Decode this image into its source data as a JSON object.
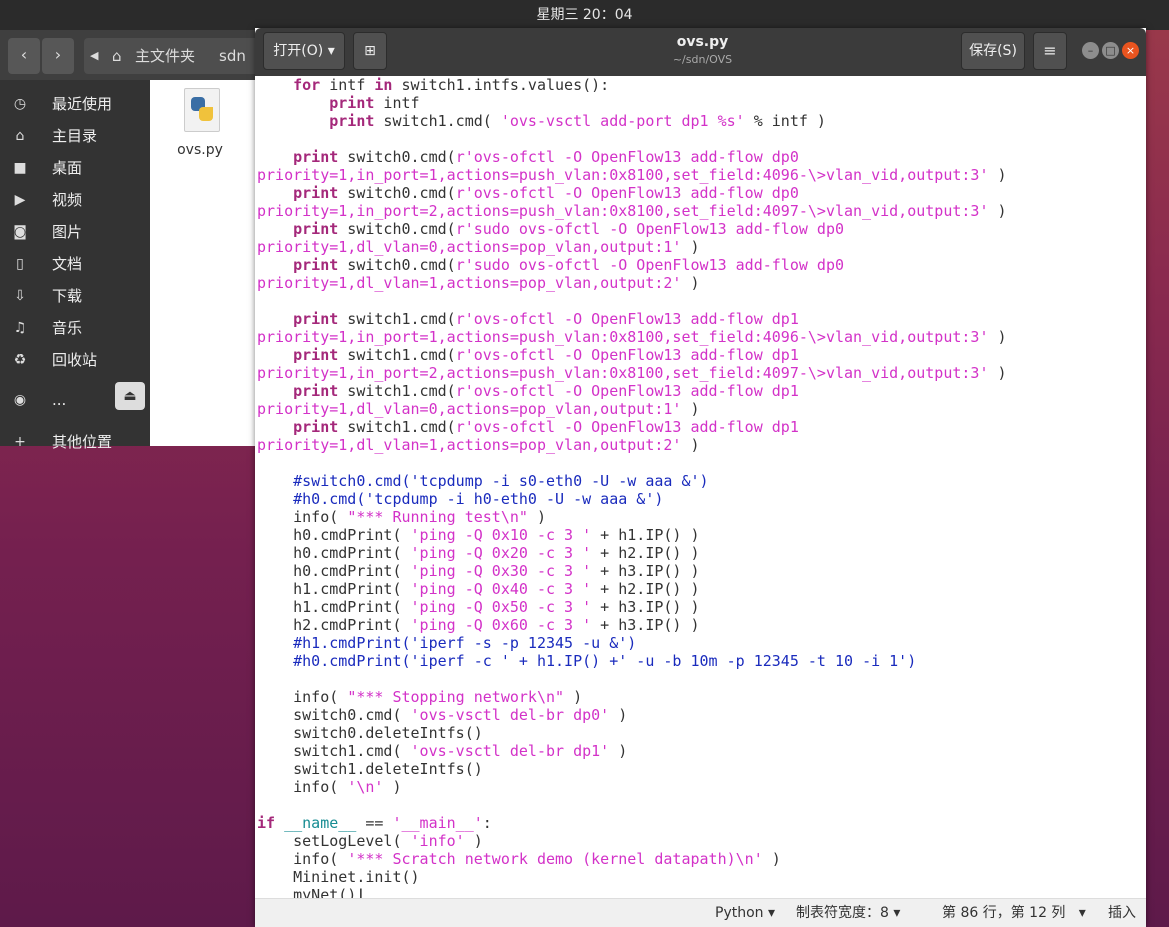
{
  "topbar": {
    "clock": "星期三 20：04"
  },
  "files": {
    "nav_back": "‹",
    "nav_fwd": "›",
    "crumb_home": "主文件夹",
    "crumb_sdn": "sdn",
    "sidebar": [
      {
        "icon": "clock-icon",
        "glyph": "◷",
        "label": "最近使用"
      },
      {
        "icon": "home-icon",
        "glyph": "⌂",
        "label": "主目录"
      },
      {
        "icon": "folder-icon",
        "glyph": "■",
        "label": "桌面"
      },
      {
        "icon": "video-icon",
        "glyph": "▶",
        "label": "视频"
      },
      {
        "icon": "camera-icon",
        "glyph": "◙",
        "label": "图片"
      },
      {
        "icon": "document-icon",
        "glyph": "▯",
        "label": "文档"
      },
      {
        "icon": "download-icon",
        "glyph": "⇩",
        "label": "下载"
      },
      {
        "icon": "music-icon",
        "glyph": "♫",
        "label": "音乐"
      },
      {
        "icon": "trash-icon",
        "glyph": "♻",
        "label": "回收站"
      },
      {
        "icon": "disk-icon",
        "glyph": "◉",
        "label": "..."
      },
      {
        "icon": "plus-icon",
        "glyph": "+",
        "label": "其他位置"
      }
    ],
    "eject": "⏏",
    "file_name": "ovs.py"
  },
  "editor": {
    "open_label": "打开(O)",
    "open_arrow": "▾",
    "new_tab": "⊞",
    "title": "ovs.py",
    "subtitle": "~/sdn/OVS",
    "save_label": "保存(S)",
    "menu": "≡",
    "min": "–",
    "max": "□",
    "close": "×",
    "code": [
      [
        [
          "",
          "    "
        ],
        [
          "kw",
          "for"
        ],
        [
          "",
          " intf "
        ],
        [
          "kw",
          "in"
        ],
        [
          "",
          " switch1.intfs.values():"
        ]
      ],
      [
        [
          "",
          "        "
        ],
        [
          "kw",
          "print"
        ],
        [
          "",
          " intf"
        ]
      ],
      [
        [
          "",
          "        "
        ],
        [
          "kw",
          "print"
        ],
        [
          "",
          " switch1.cmd( "
        ],
        [
          "st",
          "'ovs-vsctl add-port dp1 %s'"
        ],
        [
          "",
          " % intf )"
        ]
      ],
      [
        [
          "",
          ""
        ]
      ],
      [
        [
          "",
          "    "
        ],
        [
          "kw",
          "print"
        ],
        [
          "",
          " switch0.cmd("
        ],
        [
          "st",
          "r'ovs-ofctl -O OpenFlow13 add-flow dp0"
        ]
      ],
      [
        [
          "st",
          "priority=1,in_port=1,actions=push_vlan:0x8100,set_field:4096-\\>vlan_vid,output:3' "
        ],
        [
          "",
          ")"
        ]
      ],
      [
        [
          "",
          "    "
        ],
        [
          "kw",
          "print"
        ],
        [
          "",
          " switch0.cmd("
        ],
        [
          "st",
          "r'ovs-ofctl -O OpenFlow13 add-flow dp0"
        ]
      ],
      [
        [
          "st",
          "priority=1,in_port=2,actions=push_vlan:0x8100,set_field:4097-\\>vlan_vid,output:3' "
        ],
        [
          "",
          ")"
        ]
      ],
      [
        [
          "",
          "    "
        ],
        [
          "kw",
          "print"
        ],
        [
          "",
          " switch0.cmd("
        ],
        [
          "st",
          "r'sudo ovs-ofctl -O OpenFlow13 add-flow dp0"
        ]
      ],
      [
        [
          "st",
          "priority=1,dl_vlan=0,actions=pop_vlan,output:1' "
        ],
        [
          "",
          ")"
        ]
      ],
      [
        [
          "",
          "    "
        ],
        [
          "kw",
          "print"
        ],
        [
          "",
          " switch0.cmd("
        ],
        [
          "st",
          "r'sudo ovs-ofctl -O OpenFlow13 add-flow dp0"
        ]
      ],
      [
        [
          "st",
          "priority=1,dl_vlan=1,actions=pop_vlan,output:2' "
        ],
        [
          "",
          ")"
        ]
      ],
      [
        [
          "",
          ""
        ]
      ],
      [
        [
          "",
          "    "
        ],
        [
          "kw",
          "print"
        ],
        [
          "",
          " switch1.cmd("
        ],
        [
          "st",
          "r'ovs-ofctl -O OpenFlow13 add-flow dp1"
        ]
      ],
      [
        [
          "st",
          "priority=1,in_port=1,actions=push_vlan:0x8100,set_field:4096-\\>vlan_vid,output:3' "
        ],
        [
          "",
          ")"
        ]
      ],
      [
        [
          "",
          "    "
        ],
        [
          "kw",
          "print"
        ],
        [
          "",
          " switch1.cmd("
        ],
        [
          "st",
          "r'ovs-ofctl -O OpenFlow13 add-flow dp1"
        ]
      ],
      [
        [
          "st",
          "priority=1,in_port=2,actions=push_vlan:0x8100,set_field:4097-\\>vlan_vid,output:3' "
        ],
        [
          "",
          ")"
        ]
      ],
      [
        [
          "",
          "    "
        ],
        [
          "kw",
          "print"
        ],
        [
          "",
          " switch1.cmd("
        ],
        [
          "st",
          "r'ovs-ofctl -O OpenFlow13 add-flow dp1"
        ]
      ],
      [
        [
          "st",
          "priority=1,dl_vlan=0,actions=pop_vlan,output:1' "
        ],
        [
          "",
          ")"
        ]
      ],
      [
        [
          "",
          "    "
        ],
        [
          "kw",
          "print"
        ],
        [
          "",
          " switch1.cmd("
        ],
        [
          "st",
          "r'ovs-ofctl -O OpenFlow13 add-flow dp1"
        ]
      ],
      [
        [
          "st",
          "priority=1,dl_vlan=1,actions=pop_vlan,output:2' "
        ],
        [
          "",
          ")"
        ]
      ],
      [
        [
          "",
          ""
        ]
      ],
      [
        [
          "",
          "    "
        ],
        [
          "cm",
          "#switch0.cmd('tcpdump -i s0-eth0 -U -w aaa &')"
        ]
      ],
      [
        [
          "",
          "    "
        ],
        [
          "cm",
          "#h0.cmd('tcpdump -i h0-eth0 -U -w aaa &')"
        ]
      ],
      [
        [
          "",
          "    info( "
        ],
        [
          "st",
          "\"*** Running test\\n\""
        ],
        [
          "",
          " )"
        ]
      ],
      [
        [
          "",
          "    h0.cmdPrint( "
        ],
        [
          "st",
          "'ping -Q 0x10 -c 3 '"
        ],
        [
          "",
          " + h1.IP() )"
        ]
      ],
      [
        [
          "",
          "    h0.cmdPrint( "
        ],
        [
          "st",
          "'ping -Q 0x20 -c 3 '"
        ],
        [
          "",
          " + h2.IP() )"
        ]
      ],
      [
        [
          "",
          "    h0.cmdPrint( "
        ],
        [
          "st",
          "'ping -Q 0x30 -c 3 '"
        ],
        [
          "",
          " + h3.IP() )"
        ]
      ],
      [
        [
          "",
          "    h1.cmdPrint( "
        ],
        [
          "st",
          "'ping -Q 0x40 -c 3 '"
        ],
        [
          "",
          " + h2.IP() )"
        ]
      ],
      [
        [
          "",
          "    h1.cmdPrint( "
        ],
        [
          "st",
          "'ping -Q 0x50 -c 3 '"
        ],
        [
          "",
          " + h3.IP() )"
        ]
      ],
      [
        [
          "",
          "    h2.cmdPrint( "
        ],
        [
          "st",
          "'ping -Q 0x60 -c 3 '"
        ],
        [
          "",
          " + h3.IP() )"
        ]
      ],
      [
        [
          "",
          "    "
        ],
        [
          "cm",
          "#h1.cmdPrint('iperf -s -p 12345 -u &')"
        ]
      ],
      [
        [
          "",
          "    "
        ],
        [
          "cm",
          "#h0.cmdPrint('iperf -c ' + h1.IP() +' -u -b 10m -p 12345 -t 10 -i 1')"
        ]
      ],
      [
        [
          "",
          ""
        ]
      ],
      [
        [
          "",
          "    info( "
        ],
        [
          "st",
          "\"*** Stopping network\\n\""
        ],
        [
          "",
          " )"
        ]
      ],
      [
        [
          "",
          "    switch0.cmd( "
        ],
        [
          "st",
          "'ovs-vsctl del-br dp0'"
        ],
        [
          "",
          " )"
        ]
      ],
      [
        [
          "",
          "    switch0.deleteIntfs()"
        ]
      ],
      [
        [
          "",
          "    switch1.cmd( "
        ],
        [
          "st",
          "'ovs-vsctl del-br dp1'"
        ],
        [
          "",
          " )"
        ]
      ],
      [
        [
          "",
          "    switch1.deleteIntfs()"
        ]
      ],
      [
        [
          "",
          "    info( "
        ],
        [
          "st",
          "'\\n'"
        ],
        [
          "",
          " )"
        ]
      ],
      [
        [
          "",
          ""
        ]
      ],
      [
        [
          "kw",
          "if"
        ],
        [
          "",
          " "
        ],
        [
          "bi",
          "__name__"
        ],
        [
          "",
          " == "
        ],
        [
          "st",
          "'__main__'"
        ],
        [
          "",
          ":"
        ]
      ],
      [
        [
          "",
          "    setLogLevel( "
        ],
        [
          "st",
          "'info'"
        ],
        [
          "",
          " )"
        ]
      ],
      [
        [
          "",
          "    info( "
        ],
        [
          "st",
          "'*** Scratch network demo (kernel datapath)\\n'"
        ],
        [
          "",
          " )"
        ]
      ],
      [
        [
          "",
          "    Mininet.init()"
        ]
      ],
      [
        [
          "",
          "    myNet()"
        ]
      ]
    ],
    "status": {
      "lang": "Python",
      "lang_arrow": "▾",
      "tab_width": "制表符宽度：8",
      "tab_arrow": "▾",
      "position": "第 86 行，第 12 列",
      "pos_arrow": "▾",
      "mode": "插入"
    }
  }
}
